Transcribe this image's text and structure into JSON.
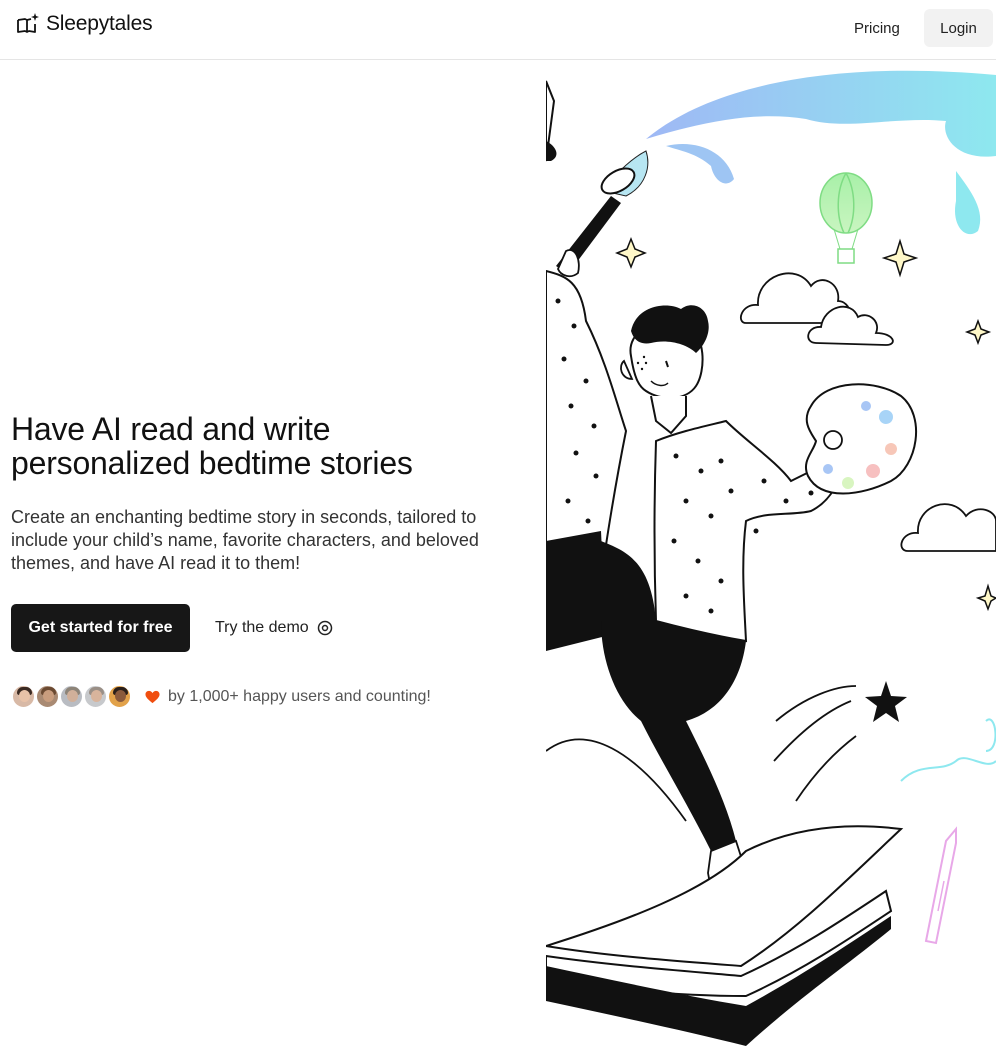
{
  "header": {
    "brand": "Sleepytales",
    "brand_icon": "book-sparkle-icon",
    "nav": {
      "pricing": "Pricing",
      "login": "Login"
    }
  },
  "hero": {
    "title_line1": "Have AI read and write",
    "title_line2": "personalized bedtime stories",
    "subtitle": "Create an enchanting bedtime story in seconds, tailored to include your child’s name, favorite characters, and beloved themes, and have AI read it to them!",
    "cta_primary": "Get started for free",
    "cta_secondary": "Try the demo",
    "cta_secondary_icon": "record-circle-icon"
  },
  "social_proof": {
    "text": "by 1,000+ happy users and counting!",
    "icon": "heart-icon",
    "heart_color": "#f04e0f"
  },
  "colors": {
    "primary_button": "#171717",
    "login_button_bg": "#f2f2f2"
  }
}
